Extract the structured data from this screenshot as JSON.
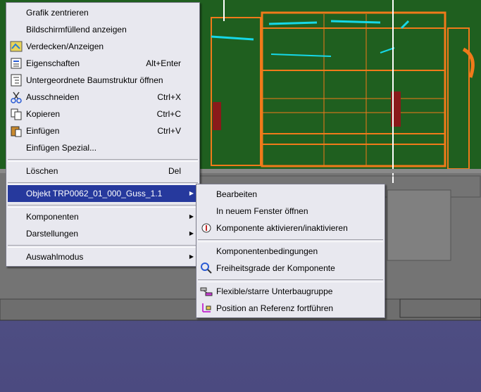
{
  "main_menu": {
    "items": [
      {
        "label": "Grafik zentrieren",
        "shortcut": "",
        "icon": ""
      },
      {
        "label": "Bildschirmfüllend anzeigen",
        "shortcut": "",
        "icon": ""
      },
      {
        "label": "Verdecken/Anzeigen",
        "shortcut": "",
        "icon": "hide-show-icon"
      },
      {
        "label": "Eigenschaften",
        "shortcut": "Alt+Enter",
        "icon": "properties-icon"
      },
      {
        "label": "Untergeordnete Baumstruktur öffnen",
        "shortcut": "",
        "icon": "tree-icon"
      },
      {
        "label": "Ausschneiden",
        "shortcut": "Ctrl+X",
        "icon": "scissors-icon"
      },
      {
        "label": "Kopieren",
        "shortcut": "Ctrl+C",
        "icon": "copy-icon"
      },
      {
        "label": "Einfügen",
        "shortcut": "Ctrl+V",
        "icon": "paste-icon"
      },
      {
        "label": "Einfügen Spezial...",
        "shortcut": "",
        "icon": ""
      },
      {
        "label": "Löschen",
        "shortcut": "Del",
        "icon": ""
      },
      {
        "label": "Objekt TRP0062_01_000_Guss_1.1",
        "shortcut": "",
        "icon": "",
        "submenu": true,
        "highlighted": true
      },
      {
        "label": "Komponenten",
        "shortcut": "",
        "icon": "",
        "submenu": true
      },
      {
        "label": "Darstellungen",
        "shortcut": "",
        "icon": "",
        "submenu": true
      },
      {
        "label": "Auswahlmodus",
        "shortcut": "",
        "icon": "",
        "submenu": true
      }
    ]
  },
  "sub_menu": {
    "items": [
      {
        "label": "Bearbeiten",
        "icon": ""
      },
      {
        "label": "In neuem Fenster öffnen",
        "icon": ""
      },
      {
        "label": "Komponente aktivieren/inaktivieren",
        "icon": "activate-icon"
      },
      {
        "label": "Komponentenbedingungen",
        "icon": ""
      },
      {
        "label": "Freiheitsgrade der Komponente",
        "icon": "dof-icon"
      },
      {
        "label": "Flexible/starre Unterbaugruppe",
        "icon": "flexible-icon"
      },
      {
        "label": "Position an Referenz fortführen",
        "icon": "position-icon"
      }
    ]
  },
  "colors": {
    "menu_bg": "#e8e8ef",
    "highlight": "#26399d",
    "cad_green": "#1f5f1f",
    "cad_orange": "#f07a1a",
    "cad_cyan": "#16d8e8",
    "background_blue": "#4d4b7e"
  }
}
